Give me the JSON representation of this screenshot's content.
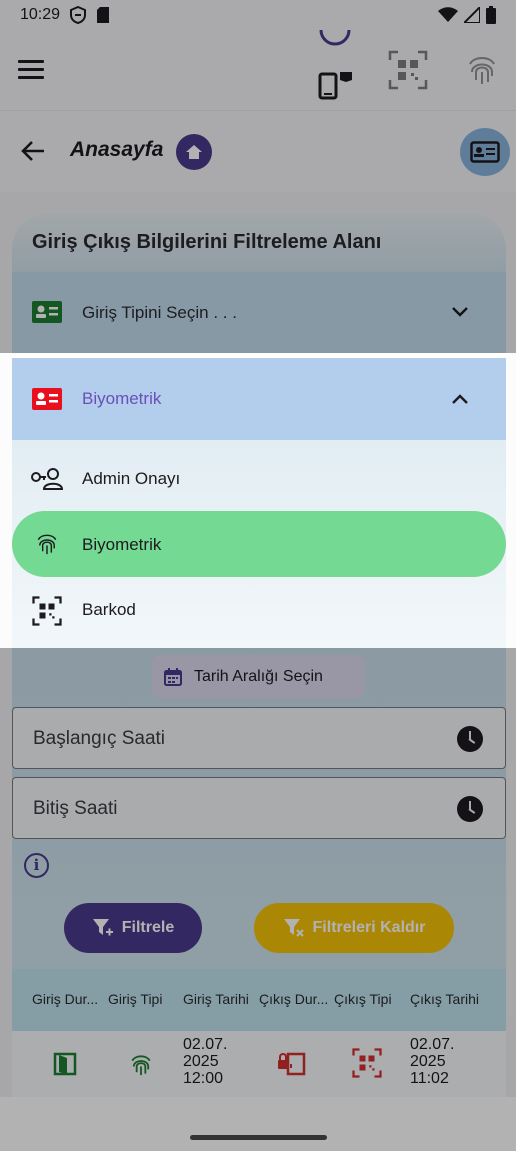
{
  "status_bar": {
    "time": "10:29"
  },
  "header": {
    "title": "Anasayfa"
  },
  "filter_panel": {
    "title": "Giriş Çıkış Bilgilerini Filtreleme Alanı",
    "entry_type_placeholder": "Giriş Tipini Seçin . . ."
  },
  "dropdown": {
    "selected": "Biyometrik",
    "items": [
      {
        "label": "Admin Onayı"
      },
      {
        "label": "Biyometrik"
      },
      {
        "label": "Barkod"
      }
    ]
  },
  "date_range_button": "Tarih Aralığı Seçin",
  "start_time_label": "Başlangıç Saati",
  "end_time_label": "Bitiş Saati",
  "filter_button": "Filtrele",
  "clear_filters_button": "Filtreleri Kaldır",
  "table": {
    "columns": [
      "Giriş Dur...",
      "Giriş Tipi",
      "Giriş Tarihi",
      "Çıkış Dur...",
      "Çıkış Tipi",
      "Çıkış Tarihi"
    ],
    "rows": [
      {
        "entry_date": [
          "02.07.",
          "2025",
          "12:00"
        ],
        "exit_date": [
          "02.07.",
          "2025",
          "11:02"
        ]
      }
    ]
  },
  "colors": {
    "primary": "#4a3a8c",
    "highlight": "#74d992",
    "warning": "#f5c20a",
    "exit_red": "#d32f2f",
    "entry_green": "#1e7d32"
  }
}
